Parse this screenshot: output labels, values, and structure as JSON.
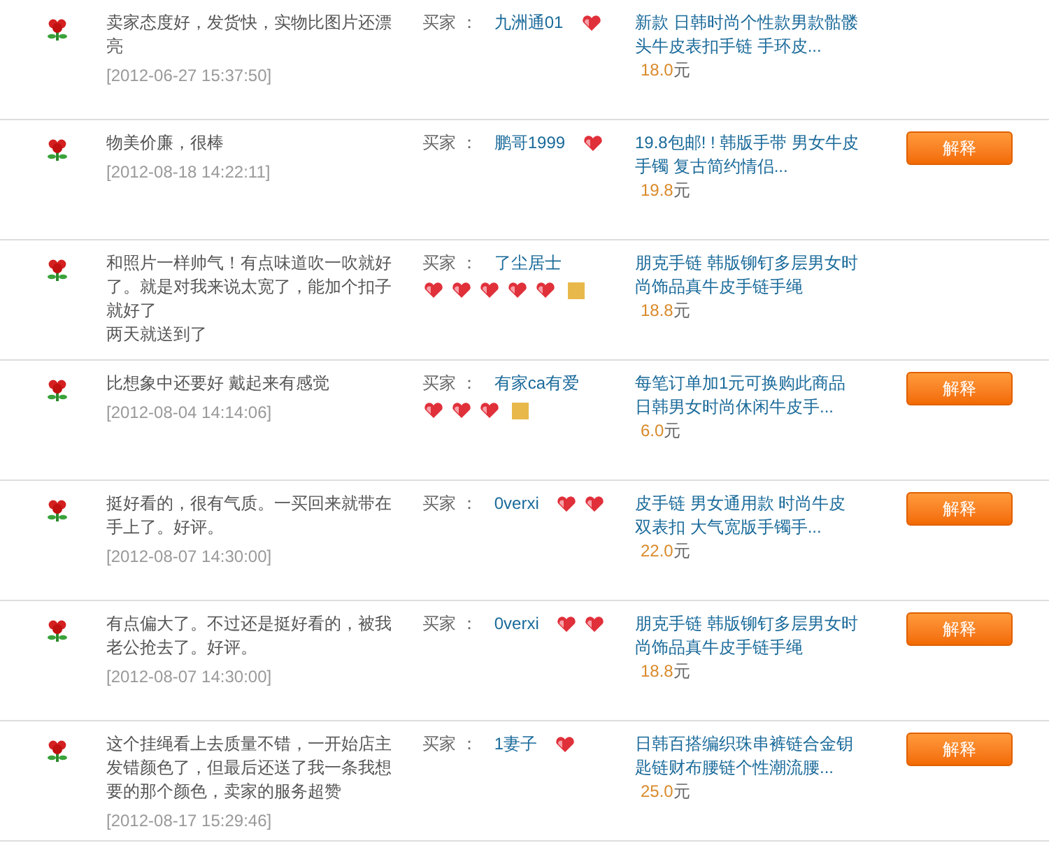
{
  "reviews": [
    {
      "comment": "卖家态度好，发货快，实物比图片还漂亮",
      "date": "[2012-06-27 15:37:50]",
      "buyer_label": "买家 ：",
      "buyer": "九洲通01",
      "rank": [
        {
          "kind": "heart"
        }
      ],
      "product": "新款 日韩时尚个性款男款骷髅头牛皮表扣手链 手环皮...",
      "price": "18.0",
      "currency": "元"
    },
    {
      "comment": "物美价廉，很棒",
      "date": "[2012-08-18 14:22:11]",
      "buyer_label": "买家 ：",
      "buyer": "鹏哥1999",
      "rank": [
        {
          "kind": "heart"
        }
      ],
      "product": "19.8包邮! ! 韩版手带 男女牛皮手镯 复古简约情侣...",
      "price": "19.8",
      "currency": "元",
      "button": "解释"
    },
    {
      "comment": "和照片一样帅气！有点味道吹一吹就好了。就是对我来说太宽了，能加个扣子就好了",
      "extra": "两天就送到了",
      "buyer_label": "买家 ：",
      "buyer": "了尘居士",
      "rank": [
        {
          "kind": "heart"
        },
        {
          "kind": "heart"
        },
        {
          "kind": "heart"
        },
        {
          "kind": "heart"
        },
        {
          "kind": "heart"
        },
        {
          "kind": "badge"
        }
      ],
      "product": "朋克手链 韩版铆钉多层男女时尚饰品真牛皮手链手绳",
      "price": "18.8",
      "currency": "元"
    },
    {
      "comment": "比想象中还要好 戴起来有感觉",
      "date": "[2012-08-04 14:14:06]",
      "buyer_label": "买家 ：",
      "buyer": "有家ca有爱",
      "rank": [
        {
          "kind": "heart"
        },
        {
          "kind": "heart"
        },
        {
          "kind": "heart"
        },
        {
          "kind": "badge"
        }
      ],
      "product": "每笔订单加1元可换购此商品日韩男女时尚休闲牛皮手...",
      "price": "6.0",
      "currency": "元",
      "button": "解释"
    },
    {
      "comment": "挺好看的，很有气质。一买回来就带在手上了。好评。",
      "date": "[2012-08-07 14:30:00]",
      "buyer_label": "买家 ：",
      "buyer": "0verxi",
      "rank": [
        {
          "kind": "heart"
        },
        {
          "kind": "heart"
        }
      ],
      "product": "皮手链 男女通用款 时尚牛皮双表扣 大气宽版手镯手...",
      "price": "22.0",
      "currency": "元",
      "button": "解释"
    },
    {
      "comment": "有点偏大了。不过还是挺好看的，被我老公抢去了。好评。",
      "date": "[2012-08-07 14:30:00]",
      "buyer_label": "买家 ：",
      "buyer": "0verxi",
      "rank": [
        {
          "kind": "heart"
        },
        {
          "kind": "heart"
        }
      ],
      "product": "朋克手链 韩版铆钉多层男女时尚饰品真牛皮手链手绳",
      "price": "18.8",
      "currency": "元",
      "button": "解释"
    },
    {
      "comment": "这个挂绳看上去质量不错，一开始店主发错颜色了，但最后还送了我一条我想要的那个颜色，卖家的服务超赞",
      "date": "[2012-08-17 15:29:46]",
      "buyer_label": "买家 ：",
      "buyer": "1妻子",
      "rank": [
        {
          "kind": "heart"
        }
      ],
      "product": "日韩百搭编织珠串裤链合金钥匙链财布腰链个性潮流腰...",
      "price": "25.0",
      "currency": "元",
      "button": "解释"
    }
  ]
}
